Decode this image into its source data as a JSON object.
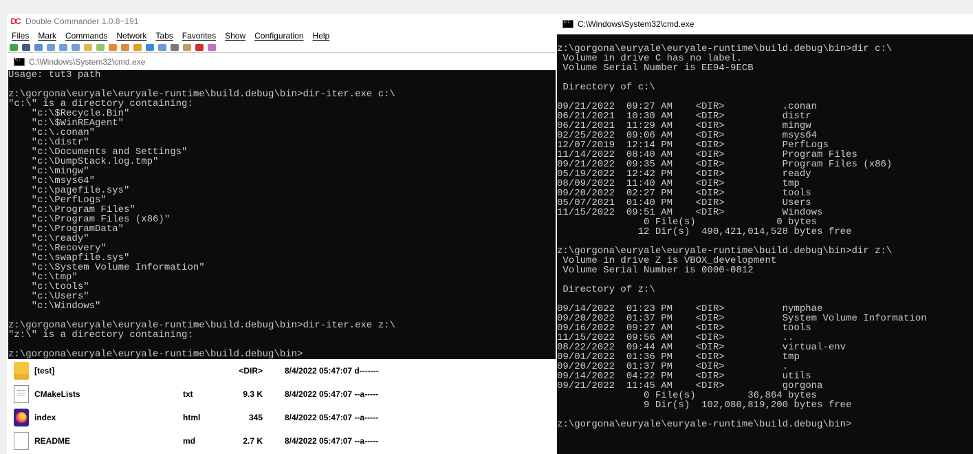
{
  "double_commander": {
    "title": "Double Commander 1.0.8~191",
    "menu": [
      "Files",
      "Mark",
      "Commands",
      "Network",
      "Tabs",
      "Favorites",
      "Show",
      "Configuration",
      "Help"
    ],
    "files": [
      {
        "name": "[test]",
        "ext": "",
        "size": "<DIR>",
        "date": "8/4/2022 05:47:07 d-------",
        "icon": "folder-icon"
      },
      {
        "name": "CMakeLists",
        "ext": "txt",
        "size": "9.3 K",
        "date": "8/4/2022 05:47:07 --a-----",
        "icon": "text-file-icon"
      },
      {
        "name": "index",
        "ext": "html",
        "size": "345",
        "date": "8/4/2022 05:47:07 --a-----",
        "icon": "firefox-html-icon"
      },
      {
        "name": "README",
        "ext": "md",
        "size": "2.7 K",
        "date": "8/4/2022 05:47:07 --a-----",
        "icon": "blank-file-icon"
      }
    ]
  },
  "cmd_left": {
    "title": "C:\\Windows\\System32\\cmd.exe",
    "lines": [
      "Usage: tut3 path",
      "",
      "z:\\gorgona\\euryale\\euryale-runtime\\build.debug\\bin>dir-iter.exe c:\\",
      "\"c:\\\" is a directory containing:",
      "    \"c:\\$Recycle.Bin\"",
      "    \"c:\\$WinREAgent\"",
      "    \"c:\\.conan\"",
      "    \"c:\\distr\"",
      "    \"c:\\Documents and Settings\"",
      "    \"c:\\DumpStack.log.tmp\"",
      "    \"c:\\mingw\"",
      "    \"c:\\msys64\"",
      "    \"c:\\pagefile.sys\"",
      "    \"c:\\PerfLogs\"",
      "    \"c:\\Program Files\"",
      "    \"c:\\Program Files (x86)\"",
      "    \"c:\\ProgramData\"",
      "    \"c:\\ready\"",
      "    \"c:\\Recovery\"",
      "    \"c:\\swapfile.sys\"",
      "    \"c:\\System Volume Information\"",
      "    \"c:\\tmp\"",
      "    \"c:\\tools\"",
      "    \"c:\\Users\"",
      "    \"c:\\Windows\"",
      "",
      "z:\\gorgona\\euryale\\euryale-runtime\\build.debug\\bin>dir-iter.exe z:\\",
      "\"z:\\\" is a directory containing:",
      "",
      "z:\\gorgona\\euryale\\euryale-runtime\\build.debug\\bin>"
    ]
  },
  "cmd_right": {
    "title": "C:\\Windows\\System32\\cmd.exe",
    "lines": [
      "",
      "z:\\gorgona\\euryale\\euryale-runtime\\build.debug\\bin>dir c:\\",
      " Volume in drive C has no label.",
      " Volume Serial Number is EE94-9ECB",
      "",
      " Directory of c:\\",
      "",
      "09/21/2022  09:27 AM    <DIR>          .conan",
      "06/21/2021  10:30 AM    <DIR>          distr",
      "06/21/2021  11:29 AM    <DIR>          mingw",
      "02/25/2022  09:06 AM    <DIR>          msys64",
      "12/07/2019  12:14 PM    <DIR>          PerfLogs",
      "11/14/2022  08:40 AM    <DIR>          Program Files",
      "09/21/2022  09:35 AM    <DIR>          Program Files (x86)",
      "05/19/2022  12:42 PM    <DIR>          ready",
      "08/09/2022  11:40 AM    <DIR>          tmp",
      "09/20/2022  02:27 PM    <DIR>          tools",
      "05/07/2021  01:40 PM    <DIR>          Users",
      "11/15/2022  09:51 AM    <DIR>          Windows",
      "               0 File(s)              0 bytes",
      "              12 Dir(s)  490,421,014,528 bytes free",
      "",
      "z:\\gorgona\\euryale\\euryale-runtime\\build.debug\\bin>dir z:\\",
      " Volume in drive Z is VBOX_development",
      " Volume Serial Number is 0000-0812",
      "",
      " Directory of z:\\",
      "",
      "09/14/2022  01:23 PM    <DIR>          nymphae",
      "09/20/2022  01:37 PM    <DIR>          System Volume Information",
      "09/16/2022  09:27 AM    <DIR>          tools",
      "11/15/2022  09:56 AM    <DIR>          ..",
      "08/22/2022  09:44 AM    <DIR>          virtual-env",
      "09/01/2022  01:36 PM    <DIR>          tmp",
      "09/20/2022  01:37 PM    <DIR>          .",
      "09/14/2022  04:22 PM    <DIR>          utils",
      "09/21/2022  11:45 AM    <DIR>          gorgona",
      "               0 File(s)         36,864 bytes",
      "               9 Dir(s)  102,080,819,200 bytes free",
      "",
      "z:\\gorgona\\euryale\\euryale-runtime\\build.debug\\bin>"
    ]
  }
}
